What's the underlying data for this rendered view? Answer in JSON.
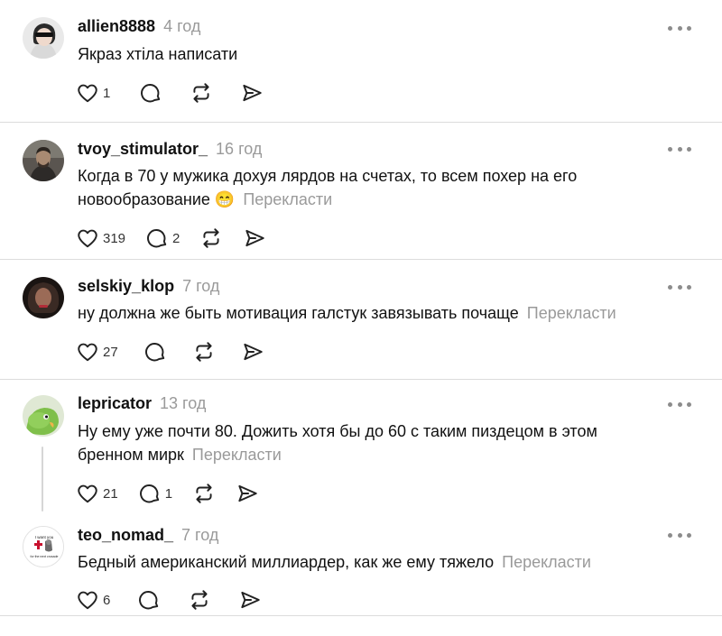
{
  "comments": [
    {
      "username": "allien8888",
      "time": "4 год",
      "text": "Якраз хтіла написати",
      "translate": "",
      "likes": "1",
      "replies": ""
    },
    {
      "username": "tvoy_stimulator_",
      "time": "16 год",
      "text": "Когда в 70 у мужика дохуя лярдов на счетах, то всем похер на его новообразование 😁",
      "translate": "Перекласти",
      "likes": "319",
      "replies": "2"
    },
    {
      "username": "selskiy_klop",
      "time": "7 год",
      "text": "ну должна же быть мотивация галстук завязывать почаще",
      "translate": "Перекласти",
      "likes": "27",
      "replies": ""
    },
    {
      "username": "lepricator",
      "time": "13 год",
      "text": "Ну ему уже почти 80. Дожить хотя бы до 60 с таким пиздецом в этом бренном мирк",
      "translate": "Перекласти",
      "likes": "21",
      "replies": "1"
    },
    {
      "username": "teo_nomad_",
      "time": "7 год",
      "text": "Бедный американский миллиардер, как же ему тяжело",
      "translate": "Перекласти",
      "likes": "6",
      "replies": ""
    }
  ],
  "avatar_badge": {
    "top": "I want you",
    "bottom": "for the next crusade"
  },
  "colors": {
    "text": "#111111",
    "muted": "#9a9a9a",
    "divider": "#dcdcdc",
    "icon": "#222222"
  }
}
